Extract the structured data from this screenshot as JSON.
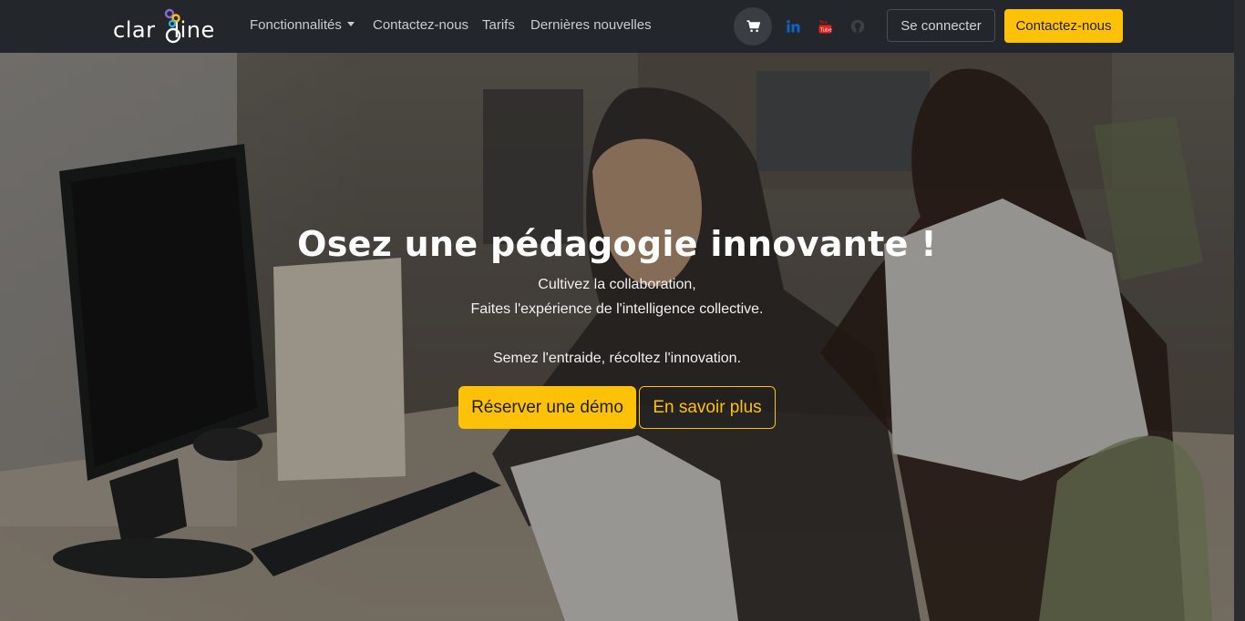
{
  "navbar": {
    "logo": {
      "text_left": "clar",
      "text_right": "line"
    },
    "links": [
      {
        "label": "Fonctionnalités",
        "has_dropdown": true
      },
      {
        "label": "Contactez-nous"
      },
      {
        "label": "Tarifs"
      },
      {
        "label": "Dernières nouvelles"
      }
    ],
    "icons": [
      "cart-icon",
      "linkedin-icon",
      "youtube-icon",
      "github-icon"
    ],
    "login_label": "Se connecter",
    "contact_label": "Contactez-nous"
  },
  "hero": {
    "title": "Osez une pédagogie innovante !",
    "lines": [
      "Cultivez la collaboration,",
      "Faites l'expérience de l'intelligence collective.",
      "Semez l'entraide, récoltez l'innovation."
    ],
    "demo_label": "Réserver une démo",
    "more_label": "En savoir plus"
  },
  "colors": {
    "navbar_bg": "#23262b",
    "accent": "#fdc107",
    "linkedin": "#0a66c2",
    "youtube": "#e62117",
    "github": "#3d4046"
  }
}
